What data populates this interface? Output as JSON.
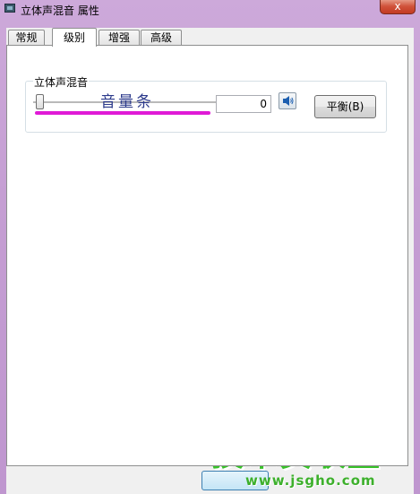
{
  "window": {
    "title": "立体声混音 属性",
    "close_glyph": "x"
  },
  "tabs": [
    {
      "label": "常规",
      "active": false
    },
    {
      "label": "级别",
      "active": true
    },
    {
      "label": "增强",
      "active": false
    },
    {
      "label": "高级",
      "active": false
    }
  ],
  "level": {
    "group_label": "立体声混音",
    "volume_value": "0",
    "volume_fraction": 0.0,
    "annotation": "音量条",
    "annotation_color": "#e01ad6",
    "balance_button": "平衡(B)"
  },
  "watermark": {
    "logo": "技术员联盟",
    "url": "www.jsgho.com",
    "color": "#38c22a"
  }
}
